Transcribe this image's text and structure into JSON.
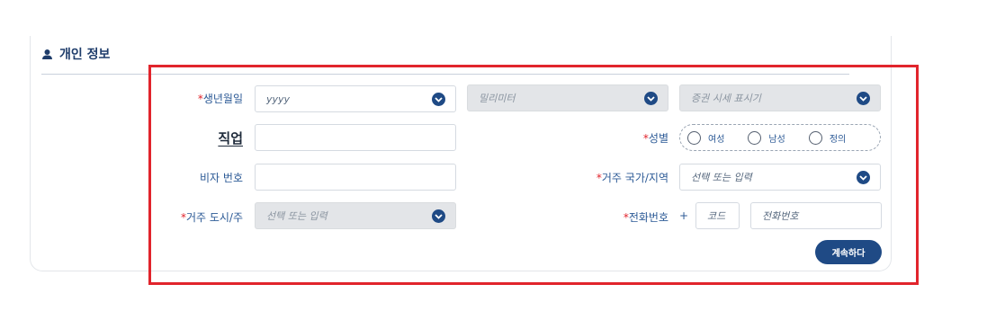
{
  "section": {
    "title": "개인 정보",
    "icon": "person-icon"
  },
  "form": {
    "birthdate": {
      "label": "생년월일",
      "required": "*",
      "year_placeholder": "yyyy",
      "month_placeholder": "밀리미터",
      "day_placeholder": "증권 시세 표시기"
    },
    "occupation": {
      "label": "직업",
      "value": ""
    },
    "gender": {
      "label": "성별",
      "required": "*",
      "options": [
        "여성",
        "남성",
        "정의"
      ]
    },
    "visa": {
      "label": "비자 번호",
      "value": ""
    },
    "country": {
      "label": "거주 국가/지역",
      "required": "*",
      "placeholder": "선택 또는 입력"
    },
    "city": {
      "label": "거주 도시/주",
      "required": "*",
      "placeholder": "선택 또는 입력"
    },
    "phone": {
      "label": "전화번호",
      "required": "*",
      "prefix": "+",
      "code_placeholder": "코드",
      "number_placeholder": "전화번호"
    },
    "continue_label": "계속하다"
  },
  "colors": {
    "accent": "#1f4a85",
    "required": "#e1242c",
    "highlight": "#e1242c",
    "label": "#2c5a96"
  }
}
